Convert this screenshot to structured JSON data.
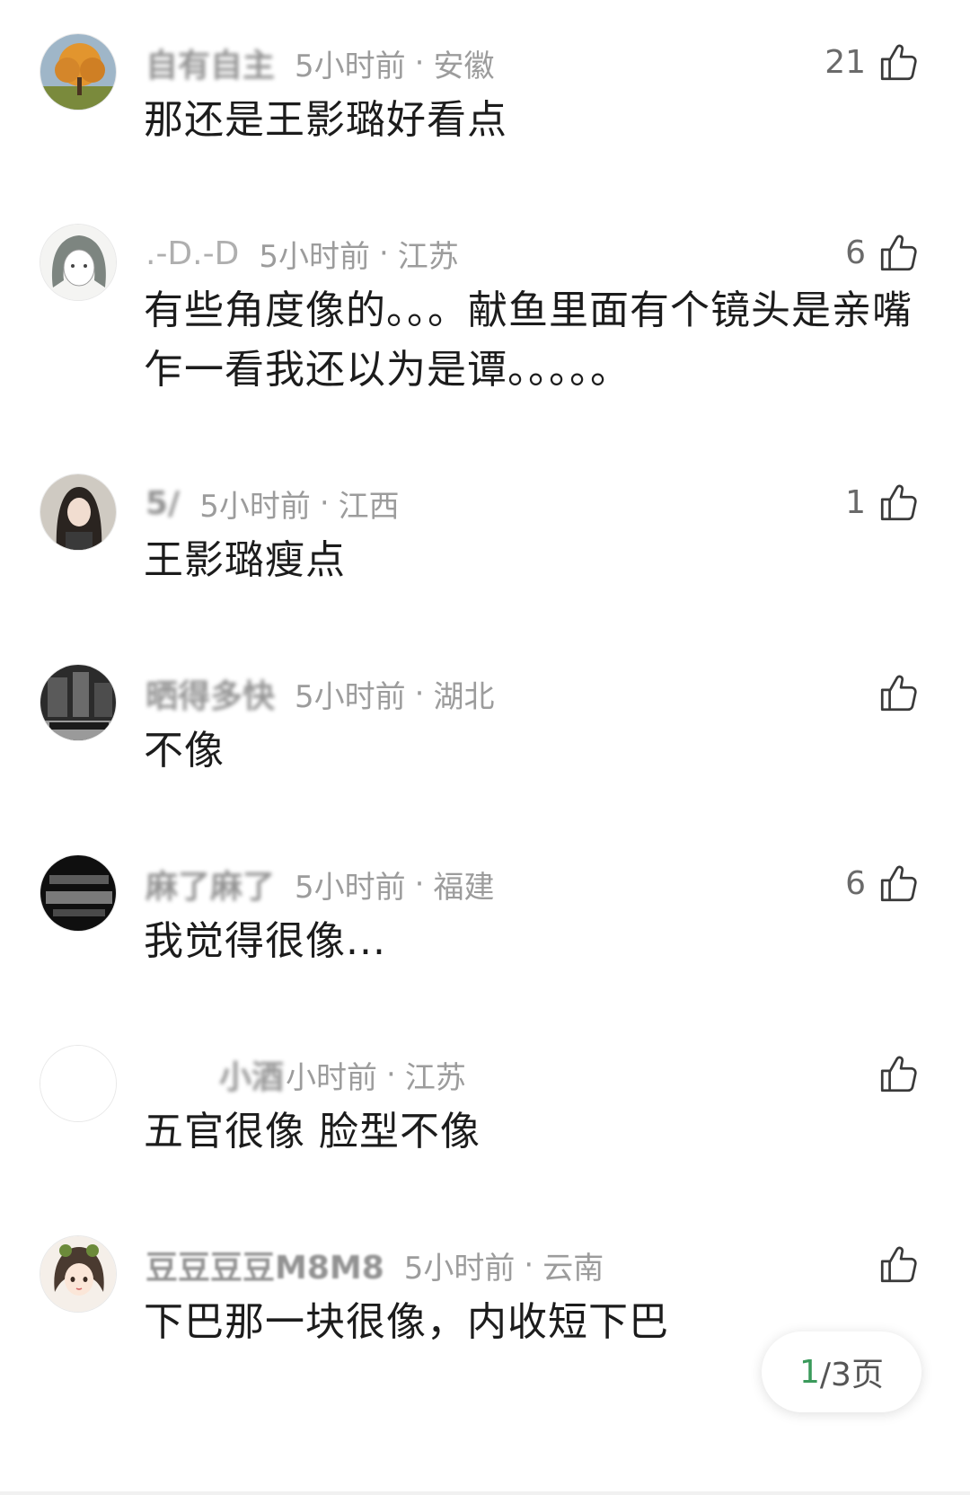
{
  "comments": [
    {
      "username": "自有自主",
      "time": "5小时前",
      "separator": "·",
      "location": "安徽",
      "text": "那还是王影璐好看点",
      "likes": "21",
      "avatar": "tree-avatar"
    },
    {
      "username": ".-D.-D",
      "time": "5小时前",
      "separator": "·",
      "location": "江苏",
      "text": "有些角度像的。。。献鱼里面有个镜头是亲嘴 乍一看我还以为是谭。。。。。",
      "likes": "6",
      "avatar": "sketch-girl-avatar"
    },
    {
      "username": "5/",
      "time": "5小时前",
      "separator": "·",
      "location": "江西",
      "text": "王影璐瘦点",
      "likes": "1",
      "avatar": "girl-photo-avatar"
    },
    {
      "username": "晒得多快",
      "time": "5小时前",
      "separator": "·",
      "location": "湖北",
      "text": "不像",
      "likes": "",
      "avatar": "dark-street-avatar"
    },
    {
      "username": "麻了麻了",
      "time": "5小时前",
      "separator": "·",
      "location": "福建",
      "text": "我觉得很像...",
      "likes": "6",
      "avatar": "text-logo-avatar"
    },
    {
      "username": "小酒",
      "time": "小时前",
      "separator": "·",
      "location": "江苏",
      "text": "五官很像 脸型不像",
      "likes": "",
      "avatar": "blank-avatar"
    },
    {
      "username": "豆豆豆豆M8M8",
      "time": "5小时前",
      "separator": "·",
      "location": "云南",
      "text": "下巴那一块很像，内收短下巴",
      "likes": "",
      "avatar": "cartoon-girl-avatar"
    }
  ],
  "pager": {
    "current": "1",
    "rest": "/3页"
  },
  "colors": {
    "pager_current": "#3a9a5b",
    "meta_text": "#9c9c9c",
    "body_text": "#1c1c1c"
  }
}
